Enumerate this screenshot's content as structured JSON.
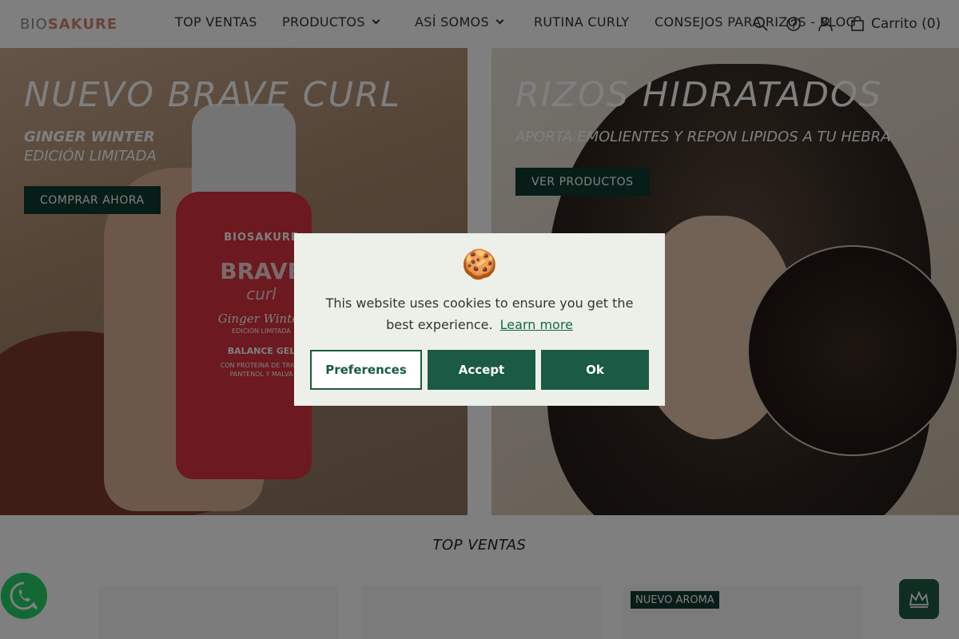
{
  "header": {
    "logo": {
      "bio": "BIO",
      "sakure": "SAKURE"
    },
    "nav": [
      {
        "label": "TOP VENTAS"
      },
      {
        "label": "PRODUCTOS"
      },
      {
        "label": "ASÍ SOMOS"
      },
      {
        "label": "RUTINA CURLY"
      },
      {
        "label": "CONSEJOS PARA RIZOS - BLOG"
      }
    ],
    "cart_label": "Carrito (0)",
    "icons": [
      "search-icon",
      "help-icon",
      "user-icon",
      "cart-icon"
    ]
  },
  "hero_left": {
    "title": "NUEVO BRAVE CURL",
    "subtitle_bold": "GINGER WINTER",
    "subtitle": "EDICIÓN LIMITADA",
    "button": "COMPRAR AHORA",
    "product": {
      "brand": "BIOSAKURE",
      "name": "BRAVE",
      "name_script": "curl",
      "variant": "Ginger Winter",
      "edition": "EDICIÓN LIMITADA",
      "type": "BALANCE GEL",
      "desc": "CON PROTEÍNA DE TRIGO PANTENOL Y MALVA"
    }
  },
  "hero_right": {
    "title": "RIZOS HIDRATADOS",
    "subtitle": "APORTA EMOLIENTES Y REPON LIPIDOS A TU HEBRA",
    "button": "VER PRODUCTOS"
  },
  "top_sellers": {
    "title": "TOP VENTAS",
    "badge": "NUEVO AROMA"
  },
  "cookie": {
    "emoji": "🍪",
    "message": "This website uses cookies to ensure you get the best experience.",
    "learn_more": "Learn more",
    "preferences": "Preferences",
    "accept": "Accept",
    "ok": "Ok"
  },
  "colors": {
    "brand_green": "#1b5a45",
    "dark_green": "#0f3b2e",
    "logo_accent": "#d6856f",
    "overlay": "rgba(0,0,0,0.5)"
  }
}
